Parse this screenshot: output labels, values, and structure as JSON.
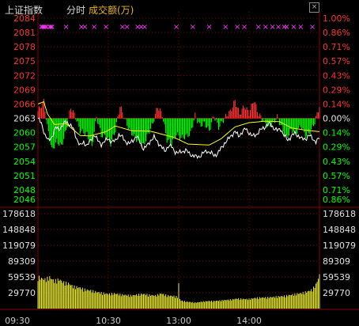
{
  "header": {
    "title": "上证指数",
    "mode": "分时",
    "subtitle": "成交额(万)"
  },
  "colors": {
    "up": "#ff3333",
    "down": "#00ff00",
    "neutral": "#e0e0e0",
    "price_line": "#ffffff",
    "avg_line": "#ffff00",
    "volume": "#dede33",
    "marker": "#ff33ff",
    "grid": "#8b0000"
  },
  "chart_data": [
    {
      "type": "line",
      "title": "上证指数",
      "ylim": [
        2046,
        2084
      ],
      "y_ticks_left": [
        {
          "v": 2084,
          "label": "2084",
          "dir": "up"
        },
        {
          "v": 2081,
          "label": "2081",
          "dir": "up"
        },
        {
          "v": 2078,
          "label": "2078",
          "dir": "up"
        },
        {
          "v": 2075,
          "label": "2075",
          "dir": "up"
        },
        {
          "v": 2072,
          "label": "2072",
          "dir": "up"
        },
        {
          "v": 2069,
          "label": "2069",
          "dir": "up"
        },
        {
          "v": 2066,
          "label": "2066",
          "dir": "up"
        },
        {
          "v": 2063,
          "label": "2063",
          "dir": "flat"
        },
        {
          "v": 2060,
          "label": "2060",
          "dir": "down"
        },
        {
          "v": 2057,
          "label": "2057",
          "dir": "down"
        },
        {
          "v": 2054,
          "label": "2054",
          "dir": "down"
        },
        {
          "v": 2051,
          "label": "2051",
          "dir": "down"
        },
        {
          "v": 2048,
          "label": "2048",
          "dir": "down"
        },
        {
          "v": 2046,
          "label": "2046",
          "dir": "down"
        }
      ],
      "y_ticks_right": [
        "1.00%",
        "0.86%",
        "0.71%",
        "0.57%",
        "0.43%",
        "0.29%",
        "0.14%",
        "0.00%",
        "0.14%",
        "0.29%",
        "0.43%",
        "0.57%",
        "0.71%",
        "0.86%"
      ],
      "x_ticks": [
        "09:30",
        "10:30",
        "13:00",
        "14:00"
      ],
      "x_tick_minutes": [
        0,
        60,
        120,
        180
      ],
      "total_minutes": 240,
      "price_keys": [
        [
          0,
          2063.0
        ],
        [
          3,
          2061.8
        ],
        [
          6,
          2059.6
        ],
        [
          9,
          2058.2
        ],
        [
          12,
          2059.2
        ],
        [
          15,
          2061.0
        ],
        [
          18,
          2060.7
        ],
        [
          21,
          2061.6
        ],
        [
          24,
          2062.3
        ],
        [
          27,
          2061.8
        ],
        [
          30,
          2060.8
        ],
        [
          33,
          2058.8
        ],
        [
          36,
          2057.2
        ],
        [
          39,
          2058.0
        ],
        [
          42,
          2057.3
        ],
        [
          45,
          2058.4
        ],
        [
          48,
          2059.6
        ],
        [
          51,
          2058.3
        ],
        [
          54,
          2057.6
        ],
        [
          57,
          2058.1
        ],
        [
          60,
          2058.8
        ],
        [
          63,
          2058.0
        ],
        [
          66,
          2058.3
        ],
        [
          69,
          2059.6
        ],
        [
          72,
          2059.0
        ],
        [
          75,
          2058.1
        ],
        [
          78,
          2057.6
        ],
        [
          81,
          2058.4
        ],
        [
          84,
          2059.3
        ],
        [
          87,
          2058.0
        ],
        [
          90,
          2056.6
        ],
        [
          93,
          2057.2
        ],
        [
          96,
          2058.4
        ],
        [
          99,
          2059.0
        ],
        [
          102,
          2058.1
        ],
        [
          105,
          2057.1
        ],
        [
          108,
          2056.1
        ],
        [
          111,
          2057.2
        ],
        [
          114,
          2057.0
        ],
        [
          117,
          2056.0
        ],
        [
          120,
          2055.7
        ],
        [
          123,
          2056.1
        ],
        [
          126,
          2056.3
        ],
        [
          129,
          2055.6
        ],
        [
          132,
          2055.2
        ],
        [
          135,
          2054.9
        ],
        [
          138,
          2055.1
        ],
        [
          141,
          2055.7
        ],
        [
          144,
          2056.2
        ],
        [
          147,
          2055.8
        ],
        [
          150,
          2055.2
        ],
        [
          153,
          2055.6
        ],
        [
          156,
          2056.6
        ],
        [
          159,
          2057.8
        ],
        [
          162,
          2058.5
        ],
        [
          165,
          2059.5
        ],
        [
          168,
          2060.2
        ],
        [
          171,
          2059.3
        ],
        [
          174,
          2060.1
        ],
        [
          177,
          2060.8
        ],
        [
          180,
          2060.0
        ],
        [
          183,
          2059.2
        ],
        [
          186,
          2059.6
        ],
        [
          189,
          2060.4
        ],
        [
          192,
          2060.9
        ],
        [
          195,
          2061.6
        ],
        [
          198,
          2061.8
        ],
        [
          201,
          2061.0
        ],
        [
          204,
          2060.4
        ],
        [
          207,
          2060.8
        ],
        [
          210,
          2059.3
        ],
        [
          213,
          2058.4
        ],
        [
          216,
          2059.3
        ],
        [
          219,
          2059.8
        ],
        [
          222,
          2059.4
        ],
        [
          225,
          2058.6
        ],
        [
          228,
          2058.7
        ],
        [
          231,
          2059.4
        ],
        [
          234,
          2058.8
        ],
        [
          237,
          2058.1
        ],
        [
          240,
          2058.8
        ]
      ],
      "avg_keys": [
        [
          0,
          2066.0
        ],
        [
          5,
          2066.5
        ],
        [
          8,
          2064.0
        ],
        [
          14,
          2061.7
        ],
        [
          24,
          2061.9
        ],
        [
          36,
          2059.4
        ],
        [
          44,
          2059.3
        ],
        [
          58,
          2060.2
        ],
        [
          66,
          2061.4
        ],
        [
          80,
          2060.4
        ],
        [
          96,
          2060.3
        ],
        [
          116,
          2059.0
        ],
        [
          128,
          2057.6
        ],
        [
          146,
          2057.4
        ],
        [
          156,
          2058.7
        ],
        [
          168,
          2061.2
        ],
        [
          180,
          2062.1
        ],
        [
          194,
          2062.4
        ],
        [
          206,
          2062.3
        ],
        [
          216,
          2061.0
        ],
        [
          226,
          2060.6
        ],
        [
          240,
          2060.2
        ]
      ],
      "bar_keys": [
        [
          0,
          2064.5
        ],
        [
          5,
          2066.6
        ],
        [
          8,
          2061.3
        ],
        [
          12,
          2056.3
        ],
        [
          16,
          2058.2
        ],
        [
          20,
          2057.2
        ],
        [
          24,
          2060.5
        ],
        [
          28,
          2065.3
        ],
        [
          32,
          2063.3
        ],
        [
          36,
          2060.4
        ],
        [
          42,
          2059.7
        ],
        [
          46,
          2057.0
        ],
        [
          50,
          2063.4
        ],
        [
          54,
          2059.5
        ],
        [
          58,
          2059.2
        ],
        [
          62,
          2057.7
        ],
        [
          66,
          2060.5
        ],
        [
          70,
          2065.6
        ],
        [
          74,
          2062.8
        ],
        [
          78,
          2060.6
        ],
        [
          82,
          2059.2
        ],
        [
          86,
          2058.1
        ],
        [
          90,
          2057.3
        ],
        [
          94,
          2059.8
        ],
        [
          98,
          2062.0
        ],
        [
          102,
          2065.5
        ],
        [
          106,
          2063.8
        ],
        [
          110,
          2058.5
        ],
        [
          114,
          2057.7
        ],
        [
          118,
          2059.7
        ],
        [
          122,
          2058.9
        ],
        [
          126,
          2059.2
        ],
        [
          130,
          2059.8
        ],
        [
          134,
          2063.6
        ],
        [
          138,
          2061.5
        ],
        [
          142,
          2062.0
        ],
        [
          146,
          2060.4
        ],
        [
          150,
          2063.6
        ],
        [
          154,
          2061.1
        ],
        [
          160,
          2063.4
        ],
        [
          164,
          2064.4
        ],
        [
          168,
          2066.7
        ],
        [
          172,
          2063.9
        ],
        [
          176,
          2065.6
        ],
        [
          180,
          2064.1
        ],
        [
          184,
          2066.9
        ],
        [
          188,
          2063.9
        ],
        [
          192,
          2062.6
        ],
        [
          196,
          2061.3
        ],
        [
          200,
          2061.8
        ],
        [
          204,
          2063.3
        ],
        [
          208,
          2061.0
        ],
        [
          212,
          2058.9
        ],
        [
          216,
          2060.6
        ],
        [
          220,
          2059.9
        ],
        [
          224,
          2061.5
        ],
        [
          228,
          2059.3
        ],
        [
          232,
          2060.0
        ],
        [
          236,
          2062.2
        ],
        [
          240,
          2065.6
        ]
      ],
      "markers": [
        3,
        4,
        5,
        6,
        7,
        10,
        11,
        12,
        24,
        37,
        40,
        48,
        58,
        72,
        76,
        85,
        88,
        91,
        118,
        132,
        146,
        160,
        170,
        176,
        188,
        194,
        200,
        205,
        210,
        212,
        218,
        224,
        234
      ]
    },
    {
      "type": "bar",
      "title": "成交额(万)",
      "ylim": [
        0,
        178618
      ],
      "y_ticks": [
        {
          "v": 178618,
          "label": "178618"
        },
        {
          "v": 148848,
          "label": "148848"
        },
        {
          "v": 119079,
          "label": "119079"
        },
        {
          "v": 89309,
          "label": "89309"
        },
        {
          "v": 59539,
          "label": "59539"
        },
        {
          "v": 29770,
          "label": "29770"
        }
      ],
      "vol_keys": [
        [
          0,
          63000
        ],
        [
          3,
          60000
        ],
        [
          6,
          58000
        ],
        [
          10,
          62000
        ],
        [
          14,
          55000
        ],
        [
          18,
          58000
        ],
        [
          22,
          52000
        ],
        [
          26,
          50000
        ],
        [
          30,
          44000
        ],
        [
          35,
          42000
        ],
        [
          40,
          38000
        ],
        [
          45,
          36000
        ],
        [
          50,
          33000
        ],
        [
          55,
          31000
        ],
        [
          60,
          29000
        ],
        [
          65,
          30000
        ],
        [
          70,
          28000
        ],
        [
          75,
          27000
        ],
        [
          80,
          26000
        ],
        [
          85,
          28000
        ],
        [
          90,
          29000
        ],
        [
          95,
          27000
        ],
        [
          100,
          26000
        ],
        [
          105,
          30000
        ],
        [
          110,
          26000
        ],
        [
          115,
          25000
        ],
        [
          118,
          24000
        ],
        [
          120,
          22000
        ],
        [
          122,
          16000
        ],
        [
          126,
          14000
        ],
        [
          130,
          13000
        ],
        [
          135,
          12000
        ],
        [
          140,
          14000
        ],
        [
          145,
          15000
        ],
        [
          150,
          15000
        ],
        [
          155,
          16000
        ],
        [
          160,
          17000
        ],
        [
          165,
          18000
        ],
        [
          170,
          20000
        ],
        [
          175,
          19000
        ],
        [
          180,
          19000
        ],
        [
          185,
          21000
        ],
        [
          190,
          22000
        ],
        [
          195,
          22000
        ],
        [
          200,
          23000
        ],
        [
          205,
          24000
        ],
        [
          210,
          25000
        ],
        [
          215,
          27000
        ],
        [
          220,
          29000
        ],
        [
          225,
          31000
        ],
        [
          230,
          34000
        ],
        [
          234,
          38000
        ],
        [
          237,
          48000
        ],
        [
          240,
          66000
        ]
      ],
      "vol_spike_minute": 120,
      "vol_spike_value": 48000
    }
  ]
}
